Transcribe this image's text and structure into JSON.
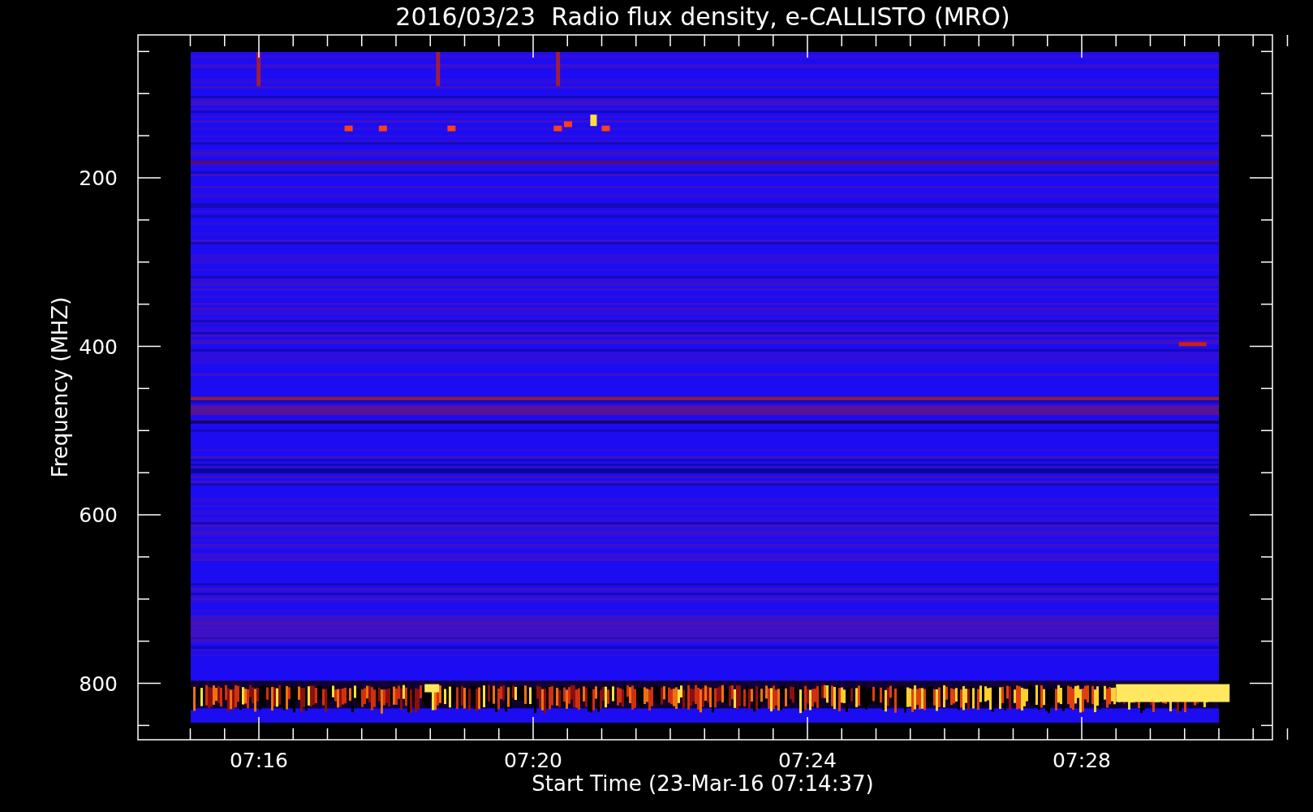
{
  "title": "2016/03/23  Radio flux density, e-CALLISTO (MRO)",
  "y_axis": {
    "label": "Frequency (MHZ)",
    "ticks": [
      "200",
      "400",
      "600",
      "800"
    ]
  },
  "x_axis": {
    "label": "Start Time (23-Mar-16 07:14:37)",
    "ticks": [
      "07:16",
      "07:20",
      "07:24",
      "07:28"
    ]
  }
}
